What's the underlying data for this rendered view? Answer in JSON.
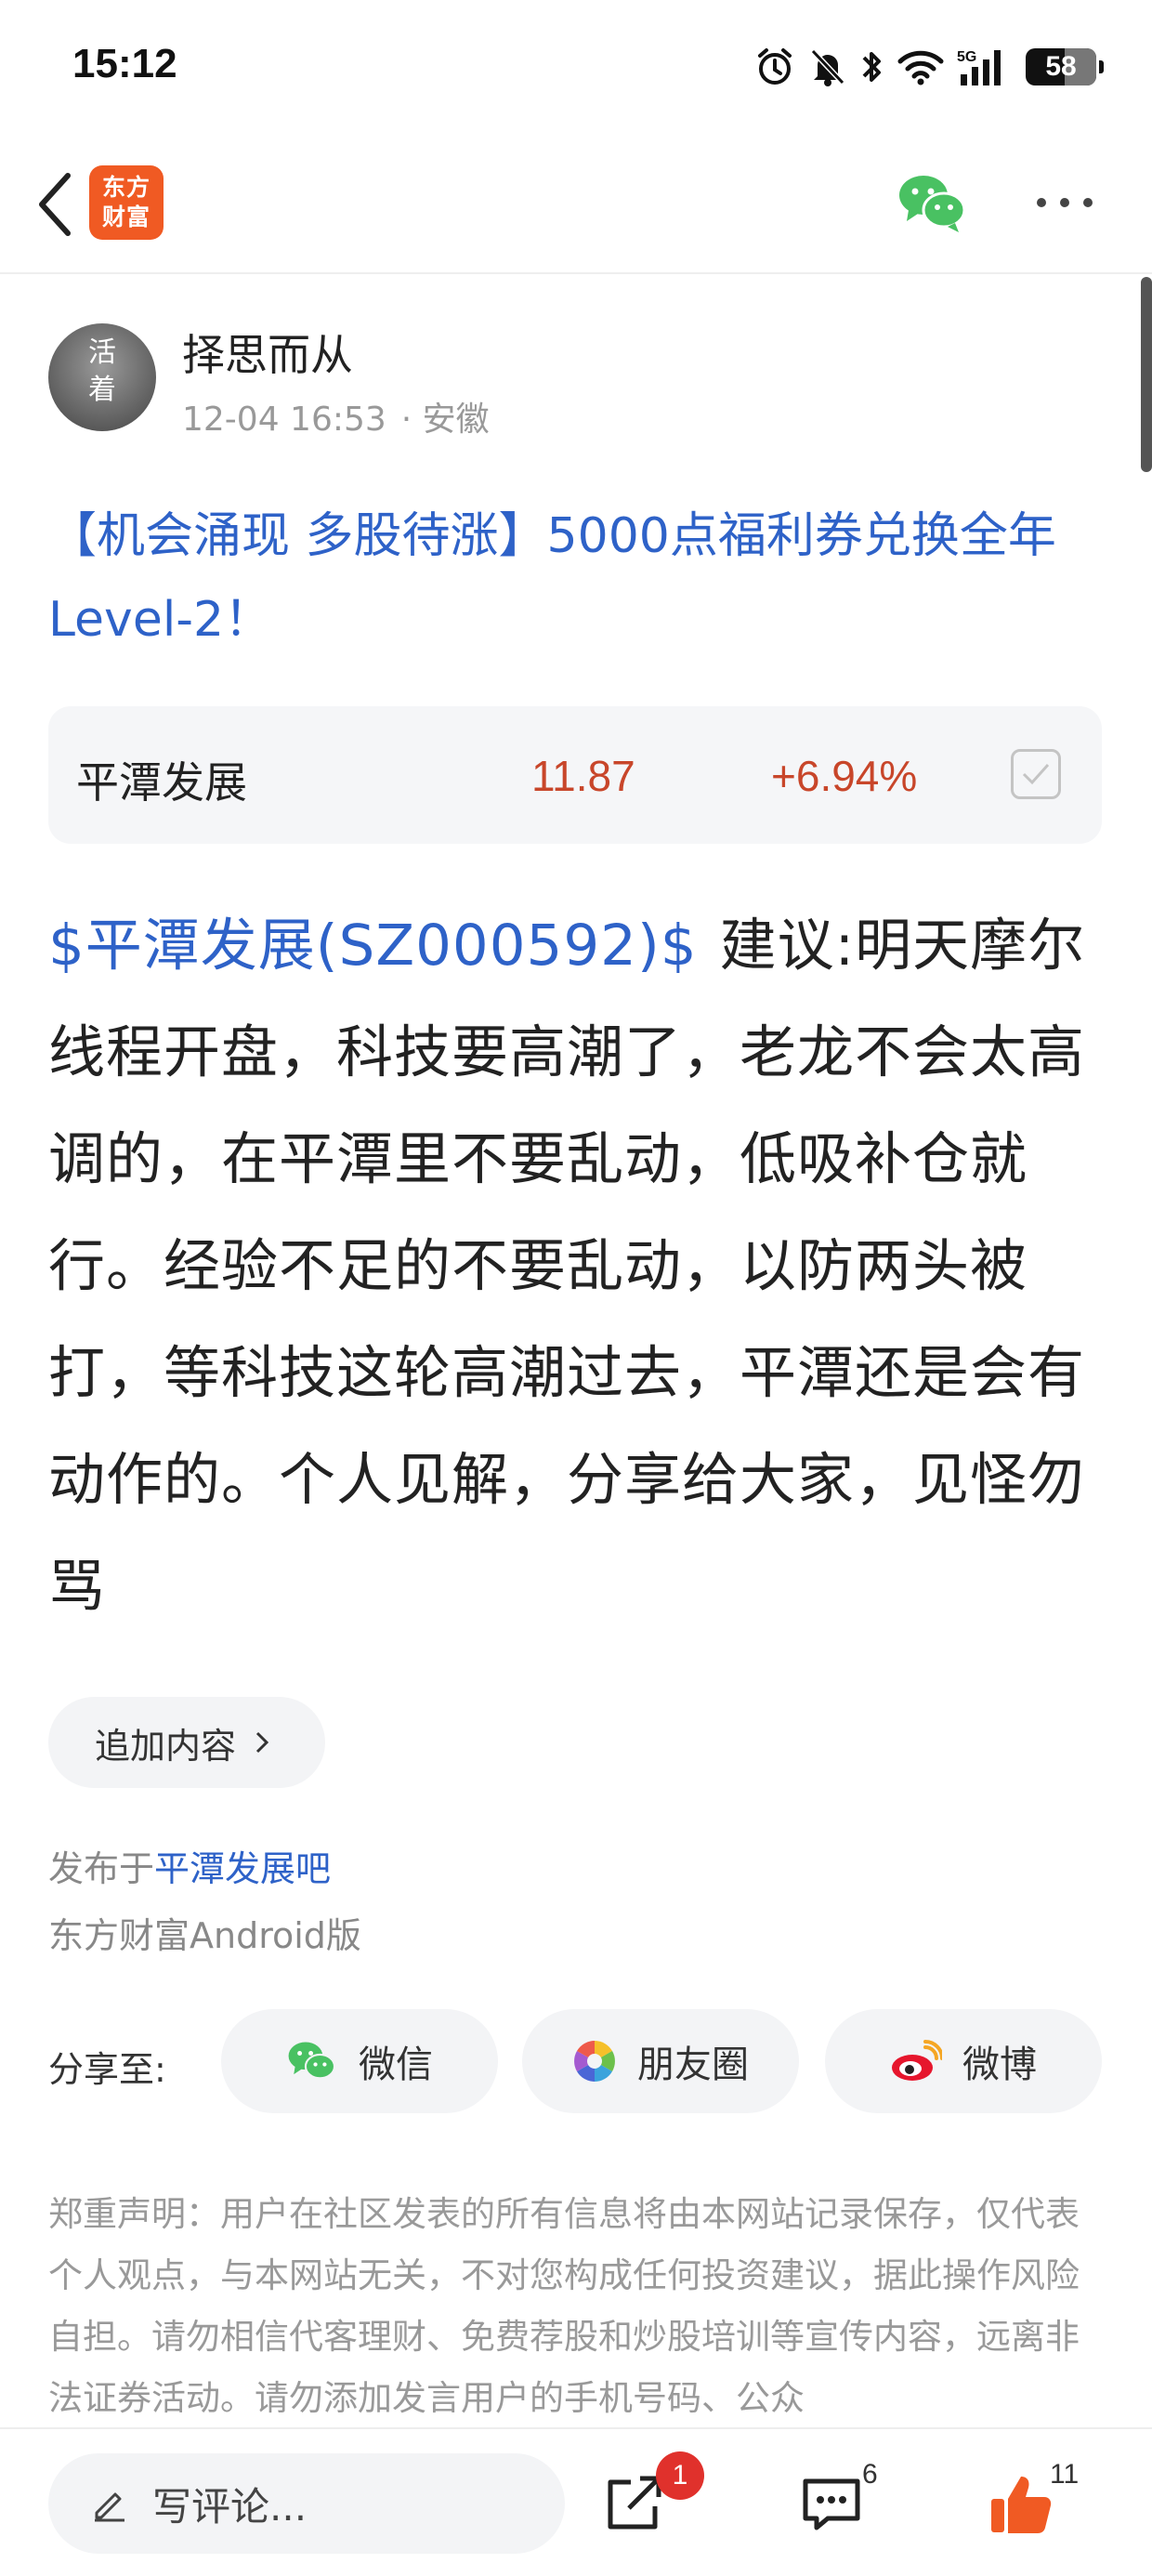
{
  "status_bar": {
    "time": "15:12",
    "battery": "58",
    "network": "5G",
    "icons": [
      "alarm-icon",
      "mute-bell-icon",
      "bluetooth-icon",
      "wifi-icon",
      "signal-icon",
      "battery-icon"
    ]
  },
  "nav": {
    "back_icon": "chevron-left-icon",
    "logo_text_line1": "东方",
    "logo_text_line2": "财富",
    "wechat_icon": "wechat-icon",
    "more_icon": "more-dots-icon"
  },
  "author": {
    "name": "择思而从",
    "date": "12-04 16:53",
    "location": "· 安徽",
    "avatar_text": "活着"
  },
  "post": {
    "title": "【机会涌现 多股待涨】5000点福利券兑换全年Level-2！",
    "stock_link": "$平潭发展(SZ000592)$",
    "body": "建议:明天摩尔线程开盘，科技要高潮了，老龙不会太高调的，在平潭里不要乱动，低吸补仓就行。经验不足的不要乱动，以防两头被打，等科技这轮高潮过去，平潭还是会有动作的。个人见解，分享给大家，见怪勿骂"
  },
  "stock_card": {
    "name": "平潭发展",
    "price": "11.87",
    "change": "+6.94%"
  },
  "append_label": "追加内容",
  "publish": {
    "prefix": "发布于",
    "bar_name": "平潭发展吧",
    "client": "东方财富Android版"
  },
  "share": {
    "label": "分享至:",
    "wechat": "微信",
    "moments": "朋友圈",
    "weibo": "微博"
  },
  "disclaimer": "郑重声明：用户在社区发表的所有信息将由本网站记录保存，仅代表个人观点，与本网站无关，不对您构成任何投资建议，据此操作风险自担。请勿相信代客理财、免费荐股和炒股培训等宣传内容，远离非法证券活动。请勿添加发言用户的手机号码、公众",
  "bottom": {
    "comment_placeholder": "写评论...",
    "share_badge": "1",
    "comment_count": "6",
    "like_count": "11"
  },
  "colors": {
    "link_blue": "#2e62c8",
    "price_red": "#c8462a",
    "brand_orange": "#f05a23",
    "badge_red": "#e0312c"
  }
}
